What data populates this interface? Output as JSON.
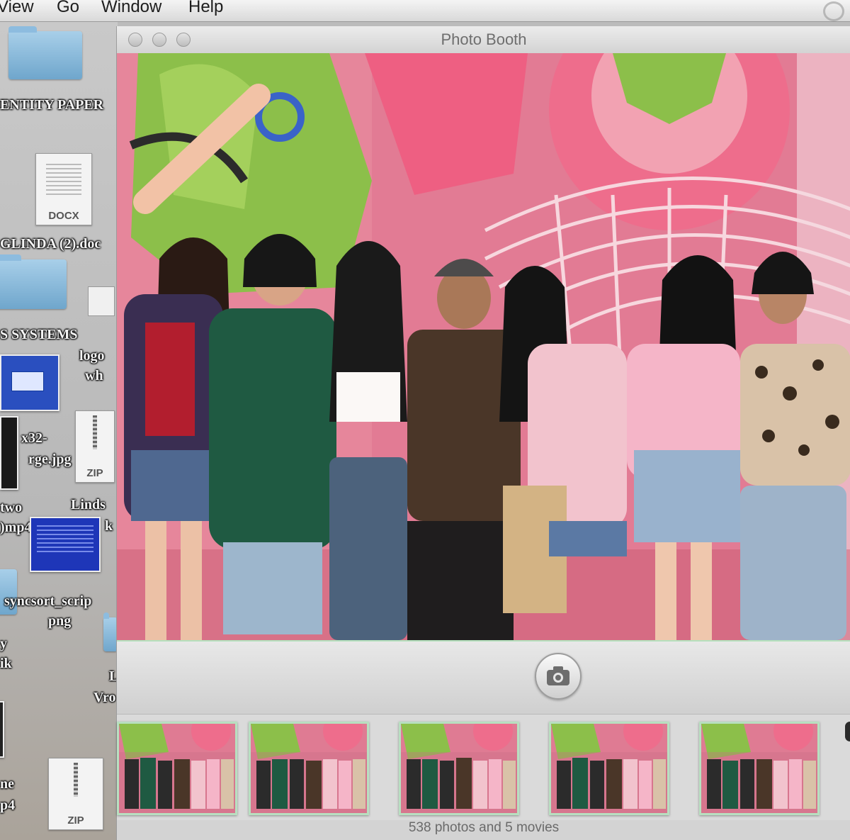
{
  "menubar": {
    "items": [
      "View",
      "Go",
      "Window",
      "Help"
    ]
  },
  "desktop": {
    "labels": {
      "identity_paper": "ENTITY PAPER",
      "glinda_doc": "GLINDA (2).doc",
      "systems": "S SYSTEMS",
      "logo": "logo",
      "logo_wh": "wh",
      "x32": "x32-",
      "rge": "rge.jpg",
      "two": "two",
      "mp4_a": ")mp4",
      "linds": "Linds",
      "linds2": "k",
      "syncsort": "syncsort_scrip",
      "png": "png",
      "y": "y",
      "ik": "ik",
      "l": "L",
      "vro": "Vro",
      "ne": "ne",
      "p4": "p4"
    },
    "icons": {
      "docx_tag": "DOCX",
      "zip_tag_1": "ZIP",
      "zip_tag_2": "ZIP"
    }
  },
  "window": {
    "title": "Photo Booth",
    "status": "538 photos and 5 movies"
  },
  "colors": {
    "backdrop_pink": "#e27b94",
    "accent_green": "#8cbf4a",
    "thumb_border": "#b8dfc0"
  },
  "icons": [
    "camera-icon",
    "folder-icon",
    "docx-file-icon",
    "zip-file-icon"
  ]
}
